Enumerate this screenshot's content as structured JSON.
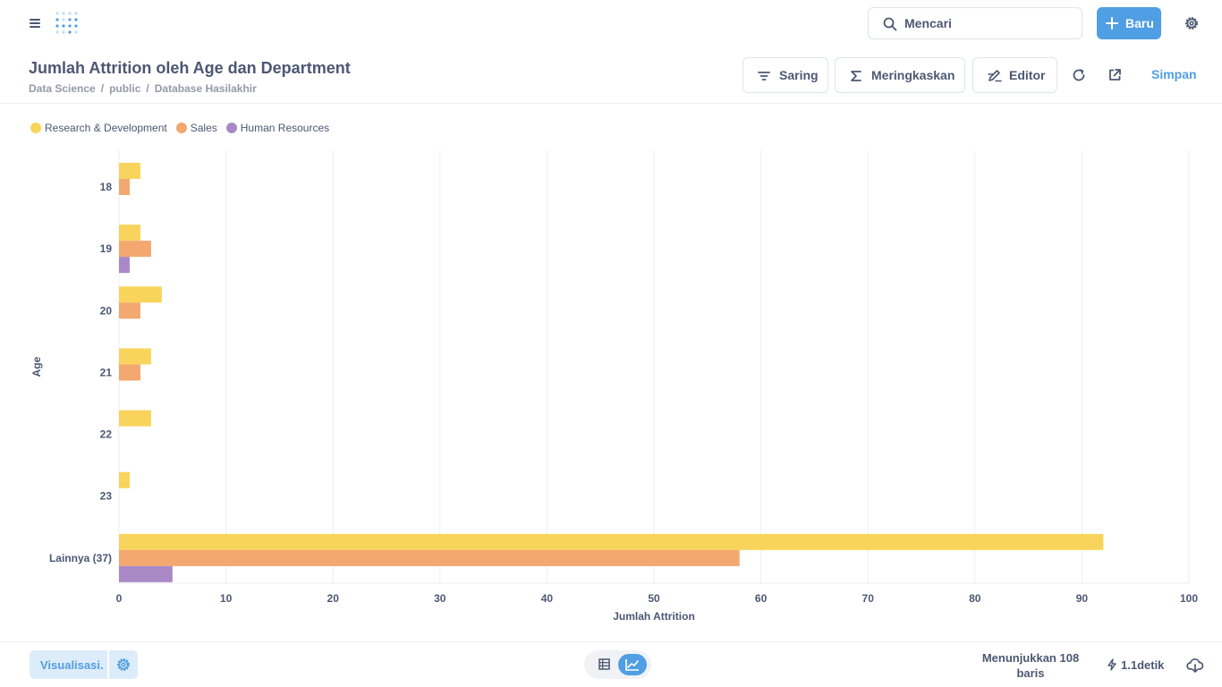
{
  "topbar": {
    "search_placeholder": "Mencari",
    "new_label": "Baru"
  },
  "header": {
    "title": "Jumlah Attrition oleh Age dan Department",
    "breadcrumb": [
      "Data Science",
      "public",
      "Database Hasilakhir"
    ],
    "filter_label": "Saring",
    "summarize_label": "Meringkaskan",
    "editor_label": "Editor",
    "save_label": "Simpan"
  },
  "legend": [
    {
      "label": "Research & Development",
      "color": "#f9d45c"
    },
    {
      "label": "Sales",
      "color": "#f2a86f"
    },
    {
      "label": "Human Resources",
      "color": "#a989c5"
    }
  ],
  "chart_data": {
    "type": "bar",
    "orientation": "horizontal",
    "categories": [
      "18",
      "19",
      "20",
      "21",
      "22",
      "23",
      "Lainnya (37)"
    ],
    "series": [
      {
        "name": "Research & Development",
        "color": "#f9d45c",
        "values": [
          2,
          2,
          4,
          3,
          3,
          1,
          92
        ]
      },
      {
        "name": "Sales",
        "color": "#f2a86f",
        "values": [
          1,
          3,
          2,
          2,
          null,
          null,
          58
        ]
      },
      {
        "name": "Human Resources",
        "color": "#a989c5",
        "values": [
          null,
          1,
          null,
          null,
          null,
          null,
          5
        ]
      }
    ],
    "xlabel": "Jumlah Attrition",
    "ylabel": "Age",
    "xlim": [
      0,
      100
    ],
    "xticks": [
      0,
      10,
      20,
      30,
      40,
      50,
      60,
      70,
      80,
      90,
      100
    ],
    "grid": "vertical",
    "legend_position": "top-left"
  },
  "footer": {
    "visualization_label": "Visualisasi.",
    "row_count": "Menunjukkan 108 baris",
    "timing": "1.1detik"
  }
}
